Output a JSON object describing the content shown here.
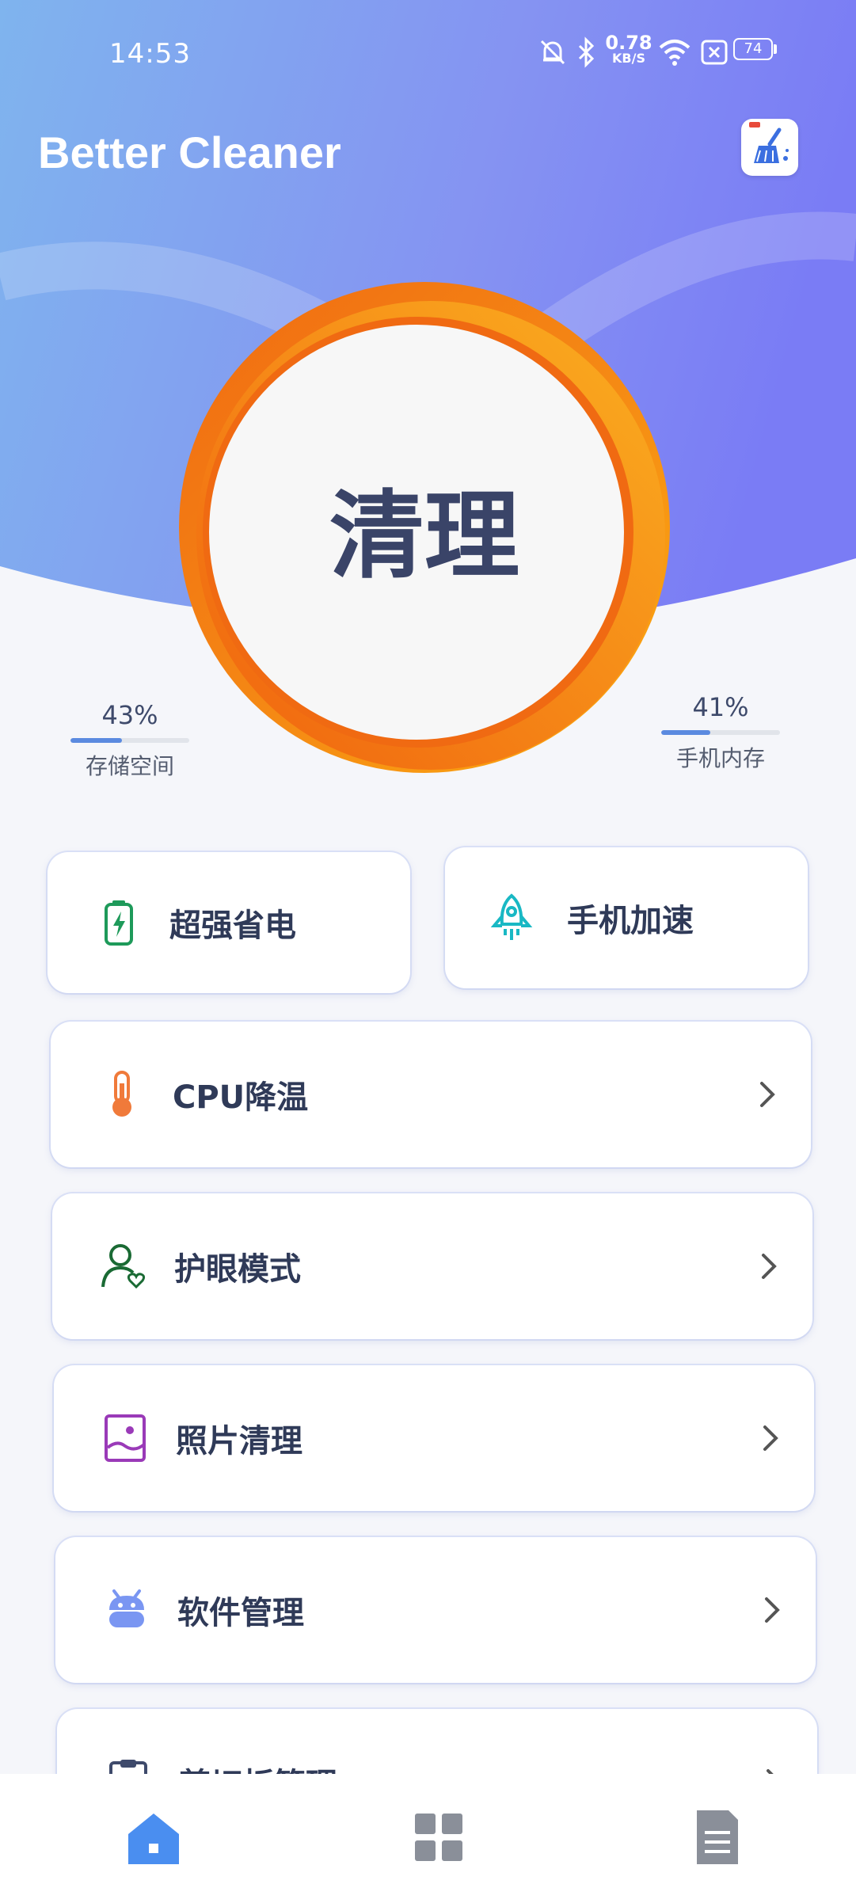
{
  "status_bar": {
    "time": "14:53",
    "network_speed_value": "0.78",
    "network_speed_unit": "KB/S",
    "battery_level": "74",
    "icons": [
      "mute-bell-icon",
      "bluetooth-icon",
      "wifi-icon",
      "sim-disabled-icon",
      "battery-icon"
    ]
  },
  "header": {
    "title": "Better Cleaner",
    "logo_icon": "broom-icon"
  },
  "clean_button": {
    "label": "清理"
  },
  "stats": {
    "storage": {
      "percent": "43%",
      "value": 0.43,
      "label": "存储空间"
    },
    "memory": {
      "percent": "41%",
      "value": 0.41,
      "label": "手机内存"
    }
  },
  "quick_actions": [
    {
      "label": "超强省电",
      "icon": "battery-charge-icon"
    },
    {
      "label": "手机加速",
      "icon": "rocket-icon"
    }
  ],
  "menu": [
    {
      "label": "CPU降温",
      "icon": "thermometer-icon"
    },
    {
      "label": "护眼模式",
      "icon": "user-heart-icon"
    },
    {
      "label": "照片清理",
      "icon": "photo-icon"
    },
    {
      "label": "软件管理",
      "icon": "android-icon"
    },
    {
      "label": "剪切板管理",
      "icon": "clipboard-icon"
    }
  ],
  "bottom_nav": [
    {
      "name": "home",
      "icon": "home-icon",
      "active": true
    },
    {
      "name": "apps",
      "icon": "grid-icon",
      "active": false
    },
    {
      "name": "docs",
      "icon": "document-icon",
      "active": false
    }
  ],
  "colors": {
    "header_gradient_start": "#7fb4ee",
    "header_gradient_end": "#7a7cf5",
    "ring_orange": "#f06a12",
    "ring_amber": "#fcaa10",
    "text_dark": "#2f3a58",
    "nav_active": "#4a8ef0",
    "nav_inactive": "#8a8f99"
  }
}
